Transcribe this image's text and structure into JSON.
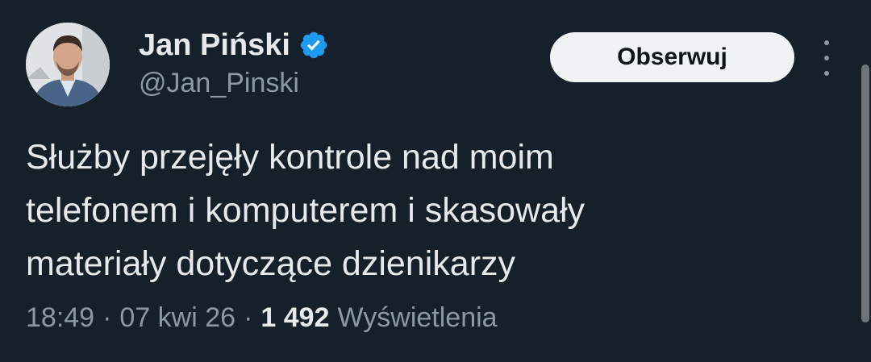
{
  "author": {
    "display_name": "Jan Piński",
    "handle": "@Jan_Pinski",
    "verified": true,
    "avatar_icon": "profile-photo-man-in-suit"
  },
  "actions": {
    "follow_label": "Obserwuj",
    "more_icon": "more-vertical-icon"
  },
  "tweet": {
    "text": "Służby przejęły kontrole nad moim\ntelefonem i komputerem i skasowały\nmateriały dotyczące dzienikarzy"
  },
  "meta": {
    "time": "18:49",
    "separator": "·",
    "date": "07 kwi 26",
    "views_count": "1 492",
    "views_label": "Wyświetlenia"
  },
  "colors": {
    "background": "#15202b",
    "text_primary": "#e7e9ea",
    "text_secondary": "#8b98a5",
    "verified_blue": "#1d9bf0",
    "follow_button_bg": "#eff3f4"
  }
}
